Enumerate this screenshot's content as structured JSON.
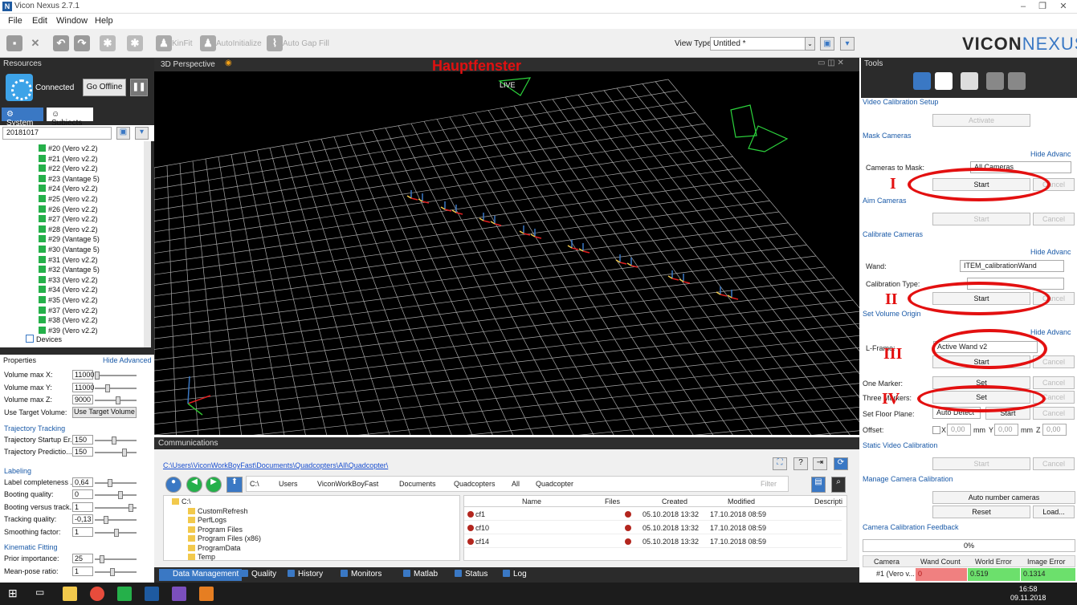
{
  "window": {
    "title": "Vicon Nexus 2.7.1",
    "app_icon": "N",
    "min": "–",
    "restore": "❐",
    "close": "✕"
  },
  "menu": [
    "File",
    "Edit",
    "Window",
    "Help"
  ],
  "toolbar": {
    "kinfit": "KinFit",
    "autoinit": "AutoInitialize",
    "autogap": "Auto Gap Fill",
    "view_type_label": "View Type:",
    "view_type_value": "Untitled *"
  },
  "logo": {
    "a": "VICON",
    "b": "NEXUS"
  },
  "resources": {
    "title": "Resources",
    "status": "Connected",
    "go_offline": "Go Offline",
    "tab_system": "System",
    "tab_subjects": "Subjects",
    "session": "20181017",
    "devices": [
      "#20 (Vero v2.2)",
      "#21 (Vero v2.2)",
      "#22 (Vero v2.2)",
      "#23 (Vantage 5)",
      "#24 (Vero v2.2)",
      "#25 (Vero v2.2)",
      "#26 (Vero v2.2)",
      "#27 (Vero v2.2)",
      "#28 (Vero v2.2)",
      "#29 (Vantage 5)",
      "#30 (Vantage 5)",
      "#31 (Vero v2.2)",
      "#32 (Vantage 5)",
      "#33 (Vero v2.2)",
      "#34 (Vero v2.2)",
      "#35 (Vero v2.2)",
      "#37 (Vero v2.2)",
      "#38 (Vero v2.2)",
      "#39 (Vero v2.2)"
    ],
    "devices_node": "Devices"
  },
  "properties": {
    "title": "Properties",
    "hide_advanced": "Hide Advanced",
    "volume": [
      {
        "label": "Volume max X:",
        "value": "11000"
      },
      {
        "label": "Volume max Y:",
        "value": "11000"
      },
      {
        "label": "Volume max Z:",
        "value": "9000"
      }
    ],
    "use_target_label": "Use Target Volume:",
    "use_target_button": "Use Target Volume",
    "sec_tracking": "Trajectory Tracking",
    "tracking": [
      {
        "label": "Trajectory Startup Er...",
        "value": "150"
      },
      {
        "label": "Trajectory Predictio...",
        "value": "150"
      }
    ],
    "sec_labeling": "Labeling",
    "labeling": [
      {
        "label": "Label completeness ...",
        "value": "0,64"
      },
      {
        "label": "Booting quality:",
        "value": "0"
      },
      {
        "label": "Booting versus track...",
        "value": "1"
      },
      {
        "label": "Tracking quality:",
        "value": "-0,13"
      },
      {
        "label": "Smoothing factor:",
        "value": "1"
      }
    ],
    "sec_kinematic": "Kinematic Fitting",
    "kinematic": [
      {
        "label": "Prior importance:",
        "value": "25"
      },
      {
        "label": "Mean-pose ratio:",
        "value": "1"
      }
    ]
  },
  "view": {
    "title": "3D Perspective",
    "annotation": "Hauptfenster",
    "live": "LIVE"
  },
  "comm": {
    "title": "Communications",
    "path": "C:\\Users\\ViconWorkBoyFast\\Documents\\Quadcopters\\All\\Quadcopter\\",
    "crumbs": [
      "C:\\",
      "Users",
      "ViconWorkBoyFast",
      "Documents",
      "Quadcopters",
      "All",
      "Quadcopter"
    ],
    "filter": "Filter",
    "tree": [
      "C:\\",
      "CustomRefresh",
      "PerfLogs",
      "Program Files",
      "Program Files (x86)",
      "ProgramData",
      "Temp"
    ],
    "file_headers": [
      "Name",
      "Files",
      "Created",
      "Modified",
      "Descripti"
    ],
    "files": [
      {
        "name": "cf1",
        "created": "05.10.2018 13:32",
        "modified": "17.10.2018 08:59"
      },
      {
        "name": "cf10",
        "created": "05.10.2018 13:32",
        "modified": "17.10.2018 08:59"
      },
      {
        "name": "cf14",
        "created": "05.10.2018 13:32",
        "modified": "17.10.2018 08:59"
      }
    ],
    "tabs": [
      "Data Management",
      "Quality",
      "History",
      "Monitors",
      "Matlab",
      "Status",
      "Log"
    ]
  },
  "tools": {
    "title": "Tools",
    "video_cal": "Video Calibration Setup",
    "activate": "Activate",
    "mask": "Mask Cameras",
    "hide_adv": "Hide Advanc",
    "cams_to_mask": "Cameras to Mask:",
    "cams_value": "All Cameras",
    "start": "Start",
    "cancel": "Cancel",
    "aim": "Aim Cameras",
    "calibrate": "Calibrate Cameras",
    "wand": "Wand:",
    "wand_value": "ITEM_calibrationWand",
    "cal_type": "Calibration Type:",
    "set_origin": "Set Volume Origin",
    "lframe": "L-Frame:",
    "lframe_value": "Active Wand v2",
    "one_marker": "One Marker:",
    "three_markers": "Three Markers:",
    "set": "Set",
    "floor": "Set Floor Plane:",
    "floor_value": "Auto Detect",
    "offset": "Offset:",
    "ox": "X",
    "oy": "Y",
    "oz": "Z",
    "zero": "0,00",
    "mm": "mm",
    "static_cal": "Static Video Calibration",
    "manage": "Manage Camera Calibration",
    "auto_number": "Auto number cameras",
    "reset": "Reset",
    "load": "Load...",
    "feedback": "Camera Calibration Feedback",
    "progress": "0%",
    "cal_headers": [
      "Camera",
      "Wand Count",
      "World Error",
      "Image Error"
    ],
    "cal_row": {
      "camera": "#1 (Vero v...",
      "wand": "0",
      "world": "0.519",
      "image": "0.1314"
    },
    "roman": [
      "I",
      "II",
      "III",
      "IV"
    ]
  },
  "taskbar": {
    "time": "16:58",
    "date": "09.11.2018"
  },
  "colors": {
    "accent": "#3a78c4",
    "connected": "#3da3e8",
    "annotation": "#e31010",
    "grid": "#b0b0b0"
  }
}
